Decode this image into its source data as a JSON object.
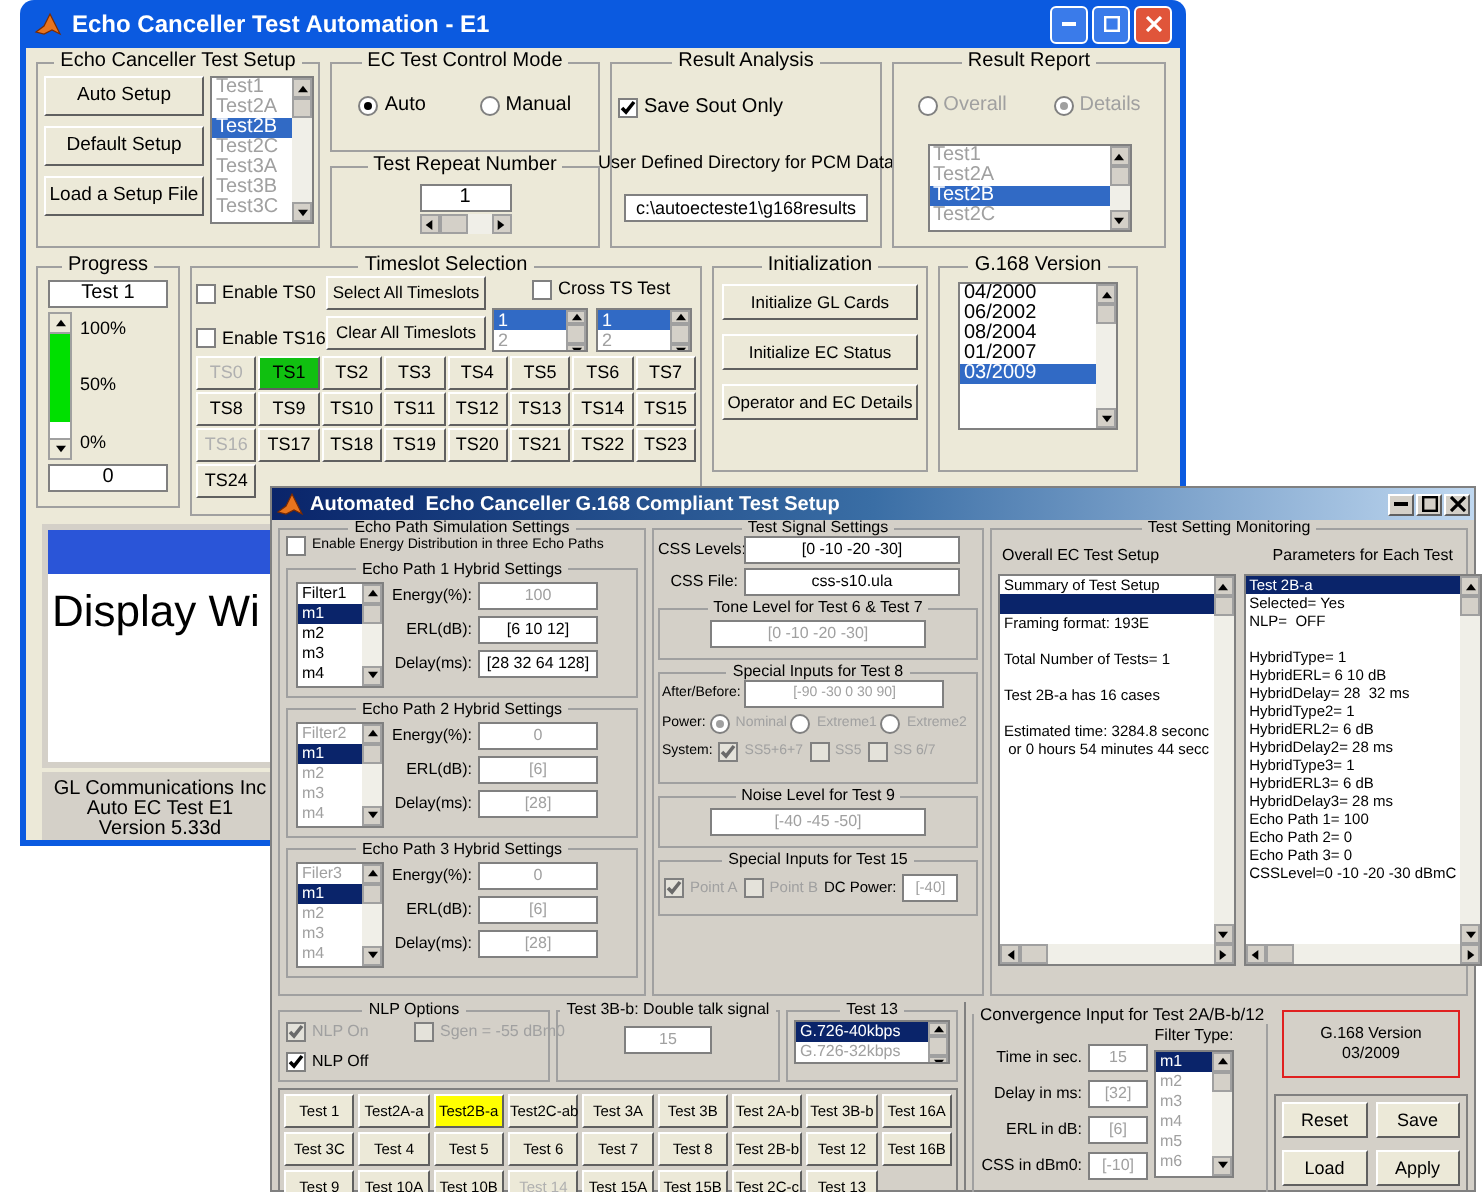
{
  "main": {
    "title": "Echo Canceller Test Automation - E1",
    "setup": {
      "title": "Echo Canceller Test Setup",
      "buttons": [
        "Auto Setup",
        "Default Setup",
        "Load a Setup File"
      ],
      "disabled": true,
      "list": [
        {
          "label": "Test1",
          "selected": false
        },
        {
          "label": "Test2A",
          "selected": false
        },
        {
          "label": "Test2B",
          "selected": true
        },
        {
          "label": "Test2C",
          "selected": false
        },
        {
          "label": "Test3A",
          "selected": false
        },
        {
          "label": "Test3B",
          "selected": false
        },
        {
          "label": "Test3C",
          "selected": false
        }
      ]
    },
    "control_mode": {
      "title": "EC Test Control Mode",
      "options": [
        {
          "label": "Auto",
          "selected": true
        },
        {
          "label": "Manual",
          "selected": false
        }
      ]
    },
    "repeat": {
      "title": "Test Repeat Number",
      "value": "1"
    },
    "analysis": {
      "title": "Result Analysis",
      "save": {
        "label": "Save Sout Only",
        "checked": true
      },
      "dir_label": "User Defined Directory for PCM Data",
      "dir_value": "c:\\autoecteste1\\g168results"
    },
    "report": {
      "title": "Result Report",
      "disabled": true,
      "options": [
        {
          "label": "Overall",
          "selected": false
        },
        {
          "label": "Details",
          "selected": true
        }
      ],
      "list": [
        {
          "label": "Test1",
          "selected": false
        },
        {
          "label": "Test2A",
          "selected": false
        },
        {
          "label": "Test2B",
          "selected": true
        },
        {
          "label": "Test2C",
          "selected": false
        }
      ]
    },
    "progress": {
      "title": "Progress",
      "test": "Test 1",
      "ticks": [
        "100%",
        "50%",
        "0%"
      ],
      "level": 0.85,
      "count": "0"
    },
    "timeslots": {
      "title": "Timeslot Selection",
      "enables": [
        {
          "label": "Enable TS0",
          "checked": false
        },
        {
          "label": "Enable TS16",
          "checked": false
        }
      ],
      "buttons": [
        "Select All Timeslots",
        "Clear All Timeslots"
      ],
      "cross": {
        "label": "Cross TS Test",
        "checked": false
      },
      "spins": [
        [
          {
            "label": "1",
            "selected": true
          },
          {
            "label": "2",
            "selected": false
          }
        ],
        [
          {
            "label": "1",
            "selected": true
          },
          {
            "label": "2",
            "selected": false
          }
        ]
      ],
      "slots": [
        {
          "label": "TS0",
          "selected": false,
          "disabled": true
        },
        {
          "label": "TS1",
          "selected": true,
          "disabled": false
        },
        {
          "label": "TS2",
          "selected": false,
          "disabled": false
        },
        {
          "label": "TS3",
          "selected": false,
          "disabled": false
        },
        {
          "label": "TS4",
          "selected": false,
          "disabled": false
        },
        {
          "label": "TS5",
          "selected": false,
          "disabled": false
        },
        {
          "label": "TS6",
          "selected": false,
          "disabled": false
        },
        {
          "label": "TS7",
          "selected": false,
          "disabled": false
        },
        {
          "label": "TS8",
          "selected": false,
          "disabled": false
        },
        {
          "label": "TS9",
          "selected": false,
          "disabled": false
        },
        {
          "label": "TS10",
          "selected": false,
          "disabled": false
        },
        {
          "label": "TS11",
          "selected": false,
          "disabled": false
        },
        {
          "label": "TS12",
          "selected": false,
          "disabled": false
        },
        {
          "label": "TS13",
          "selected": false,
          "disabled": false
        },
        {
          "label": "TS14",
          "selected": false,
          "disabled": false
        },
        {
          "label": "TS15",
          "selected": false,
          "disabled": false
        },
        {
          "label": "TS16",
          "selected": false,
          "disabled": true
        },
        {
          "label": "TS17",
          "selected": false,
          "disabled": false
        },
        {
          "label": "TS18",
          "selected": false,
          "disabled": false
        },
        {
          "label": "TS19",
          "selected": false,
          "disabled": false
        },
        {
          "label": "TS20",
          "selected": false,
          "disabled": false
        },
        {
          "label": "TS21",
          "selected": false,
          "disabled": false
        },
        {
          "label": "TS22",
          "selected": false,
          "disabled": false
        },
        {
          "label": "TS23",
          "selected": false,
          "disabled": false
        },
        {
          "label": "TS24",
          "selected": false,
          "disabled": false
        }
      ]
    },
    "init": {
      "title": "Initialization",
      "buttons": [
        "Initialize GL Cards",
        "Initialize EC Status",
        "Operator and EC Details"
      ]
    },
    "version": {
      "title": "G.168 Version",
      "list": [
        {
          "label": "04/2000",
          "selected": false
        },
        {
          "label": "06/2002",
          "selected": false
        },
        {
          "label": "08/2004",
          "selected": false
        },
        {
          "label": "01/2007",
          "selected": false
        },
        {
          "label": "03/2009",
          "selected": true
        }
      ]
    },
    "display": {
      "text": "Display Wi"
    },
    "footer": [
      "GL Communications Inc",
      "Auto EC Test E1",
      "Version 5.33d"
    ]
  },
  "dialog": {
    "title": "Automated  Echo Canceller G.168 Compliant Test Setup",
    "echo_sim": {
      "title": "Echo Path Simulation Settings",
      "distribute": {
        "label": "Enable Energy Distribution in three Echo Paths",
        "checked": false
      },
      "paths": [
        {
          "title": "Echo Path 1 Hybrid Settings",
          "disabled": false,
          "list": [
            {
              "label": "Filter1",
              "selected": false
            },
            {
              "label": "m1",
              "selected": true
            },
            {
              "label": "m2",
              "selected": false
            },
            {
              "label": "m3",
              "selected": false
            },
            {
              "label": "m4",
              "selected": false
            }
          ],
          "fields": [
            {
              "label": "Energy(%):",
              "value": "100",
              "disabled": true
            },
            {
              "label": "ERL(dB):",
              "value": "[6 10 12]",
              "disabled": false
            },
            {
              "label": "Delay(ms):",
              "value": "[28 32 64 128]",
              "disabled": false
            }
          ]
        },
        {
          "title": "Echo Path 2 Hybrid Settings",
          "disabled": true,
          "list": [
            {
              "label": "Filter2",
              "selected": false
            },
            {
              "label": "m1",
              "selected": true
            },
            {
              "label": "m2",
              "selected": false
            },
            {
              "label": "m3",
              "selected": false
            },
            {
              "label": "m4",
              "selected": false
            }
          ],
          "fields": [
            {
              "label": "Energy(%):",
              "value": "0",
              "disabled": true
            },
            {
              "label": "ERL(dB):",
              "value": "[6]",
              "disabled": true
            },
            {
              "label": "Delay(ms):",
              "value": "[28]",
              "disabled": true
            }
          ]
        },
        {
          "title": "Echo Path 3 Hybrid Settings",
          "disabled": true,
          "list": [
            {
              "label": "Filer3",
              "selected": false
            },
            {
              "label": "m1",
              "selected": true
            },
            {
              "label": "m2",
              "selected": false
            },
            {
              "label": "m3",
              "selected": false
            },
            {
              "label": "m4",
              "selected": false
            }
          ],
          "fields": [
            {
              "label": "Energy(%):",
              "value": "0",
              "disabled": true
            },
            {
              "label": "ERL(dB):",
              "value": "[6]",
              "disabled": true
            },
            {
              "label": "Delay(ms):",
              "value": "[28]",
              "disabled": true
            }
          ]
        }
      ]
    },
    "signal": {
      "title": "Test Signal Settings",
      "fields": [
        {
          "label": "CSS Levels:",
          "value": "[0 -10 -20 -30]",
          "disabled": false
        },
        {
          "label": "CSS File:",
          "value": "css-s10.ula",
          "disabled": false
        }
      ],
      "tone": {
        "title": "Tone Level for Test 6 & Test 7",
        "value": "[0 -10 -20 -30]",
        "disabled": true
      },
      "test8": {
        "title": "Special Inputs for Test 8",
        "disabled": true,
        "after_label": "After/Before:",
        "after_value": "[-90 -30 0 30 90]",
        "power_label": "Power:",
        "power": [
          {
            "label": "Nominal",
            "selected": true
          },
          {
            "label": "Extreme1",
            "selected": false
          },
          {
            "label": "Extreme2",
            "selected": false
          }
        ],
        "system_label": "System:",
        "system": [
          {
            "label": "SS5+6+7",
            "checked": true
          },
          {
            "label": "SS5",
            "checked": false
          },
          {
            "label": "SS 6/7",
            "checked": false
          }
        ]
      },
      "noise": {
        "title": "Noise Level for Test 9",
        "value": "[-40 -45 -50]",
        "disabled": true
      },
      "test15": {
        "title": "Special Inputs for Test 15",
        "disabled": true,
        "points": [
          {
            "label": "Point A",
            "checked": true
          },
          {
            "label": "Point B",
            "checked": false
          }
        ],
        "dc_label": "DC Power:",
        "dc_value": "[-40]"
      }
    },
    "monitor": {
      "title": "Test Setting Monitoring",
      "overall": {
        "title": "Overall EC Test Setup",
        "items": [
          {
            "kind": "text",
            "label": "Summary of Test Setup",
            "selected": false
          },
          {
            "kind": "blank",
            "selected": true
          },
          {
            "kind": "text",
            "label": "Framing format: 193E",
            "selected": false
          },
          {
            "kind": "gap"
          },
          {
            "kind": "text",
            "label": "Total Number of Tests= 1",
            "selected": false
          },
          {
            "kind": "gap"
          },
          {
            "kind": "text",
            "label": "Test 2B-a has 16 cases",
            "selected": false
          },
          {
            "kind": "gap"
          },
          {
            "kind": "text",
            "label": "Estimated time: 3284.8 seconc",
            "selected": false
          },
          {
            "kind": "text",
            "label": " or 0 hours 54 minutes 44 secc",
            "selected": false
          }
        ]
      },
      "params": {
        "title": "Parameters for Each Test",
        "items": [
          {
            "kind": "text",
            "label": "Test 2B-a",
            "selected": true
          },
          {
            "kind": "text",
            "label": "Selected= Yes",
            "selected": false
          },
          {
            "kind": "text",
            "label": "NLP=  OFF",
            "selected": false
          },
          {
            "kind": "gap"
          },
          {
            "kind": "text",
            "label": "HybridType= 1",
            "selected": false
          },
          {
            "kind": "text",
            "label": "HybridERL= 6 10 dB",
            "selected": false
          },
          {
            "kind": "text",
            "label": "HybridDelay= 28  32 ms",
            "selected": false
          },
          {
            "kind": "text",
            "label": "HybridType2= 1",
            "selected": false
          },
          {
            "kind": "text",
            "label": "HybridERL2= 6 dB",
            "selected": false
          },
          {
            "kind": "text",
            "label": "HybridDelay2= 28 ms",
            "selected": false
          },
          {
            "kind": "text",
            "label": "HybridType3= 1",
            "selected": false
          },
          {
            "kind": "text",
            "label": "HybridERL3= 6 dB",
            "selected": false
          },
          {
            "kind": "text",
            "label": "HybridDelay3= 28 ms",
            "selected": false
          },
          {
            "kind": "text",
            "label": "Echo Path 1= 100",
            "selected": false
          },
          {
            "kind": "text",
            "label": "Echo Path 2= 0",
            "selected": false
          },
          {
            "kind": "text",
            "label": "Echo Path 3= 0",
            "selected": false
          },
          {
            "kind": "text",
            "label": "CSSLevel=0 -10 -20 -30 dBmC",
            "selected": false
          }
        ]
      }
    },
    "nlp": {
      "title": "NLP Options",
      "options": [
        {
          "label": "NLP On",
          "checked": true,
          "disabled": true
        },
        {
          "label": "Sgen = -55 dBm0",
          "checked": false,
          "disabled": true
        },
        {
          "label": "NLP Off",
          "checked": true,
          "disabled": false
        }
      ]
    },
    "double_talk": {
      "title": "Test 3B-b: Double talk signal",
      "value": "15"
    },
    "test13": {
      "title": "Test 13",
      "list": [
        {
          "label": "G.726-40kbps",
          "selected": true
        },
        {
          "label": "G.726-32kbps",
          "selected": false
        }
      ]
    },
    "tests": [
      {
        "label": "Test 1",
        "selected": false,
        "disabled": false
      },
      {
        "label": "Test2A-a",
        "selected": false,
        "disabled": false
      },
      {
        "label": "Test2B-a",
        "selected": true,
        "disabled": false
      },
      {
        "label": "Test2C-ab",
        "selected": false,
        "disabled": false
      },
      {
        "label": "Test 3A",
        "selected": false,
        "disabled": false
      },
      {
        "label": "Test 3B",
        "selected": false,
        "disabled": false
      },
      {
        "label": "Test 2A-b",
        "selected": false,
        "disabled": false
      },
      {
        "label": "Test 3B-b",
        "selected": false,
        "disabled": false
      },
      {
        "label": "Test 16A",
        "selected": false,
        "disabled": false
      },
      {
        "label": "Test 3C",
        "selected": false,
        "disabled": false
      },
      {
        "label": "Test 4",
        "selected": false,
        "disabled": false
      },
      {
        "label": "Test 5",
        "selected": false,
        "disabled": false
      },
      {
        "label": "Test 6",
        "selected": false,
        "disabled": false
      },
      {
        "label": "Test 7",
        "selected": false,
        "disabled": false
      },
      {
        "label": "Test 8",
        "selected": false,
        "disabled": false
      },
      {
        "label": "Test 2B-b",
        "selected": false,
        "disabled": false
      },
      {
        "label": "Test 12",
        "selected": false,
        "disabled": false
      },
      {
        "label": "Test 16B",
        "selected": false,
        "disabled": false
      },
      {
        "label": "Test 9",
        "selected": false,
        "disabled": false
      },
      {
        "label": "Test 10A",
        "selected": false,
        "disabled": false
      },
      {
        "label": "Test 10B",
        "selected": false,
        "disabled": false
      },
      {
        "label": "Test 14",
        "selected": false,
        "disabled": true
      },
      {
        "label": "Test 15A",
        "selected": false,
        "disabled": false
      },
      {
        "label": "Test 15B",
        "selected": false,
        "disabled": false
      },
      {
        "label": "Test 2C-c",
        "selected": false,
        "disabled": false
      },
      {
        "label": "Test 13",
        "selected": false,
        "disabled": false
      }
    ],
    "convergence": {
      "title": "Convergence Input for Test 2A/B-b/12",
      "fields": [
        {
          "label": "Time in sec.",
          "value": "15",
          "disabled": true
        },
        {
          "label": "Delay in ms:",
          "value": "[32]",
          "disabled": true
        },
        {
          "label": "ERL in dB:",
          "value": "[6]",
          "disabled": true
        },
        {
          "label": "CSS in dBm0:",
          "value": "[-10]",
          "disabled": true
        }
      ],
      "filter_label": "Filter Type:",
      "filter": [
        {
          "label": "m1",
          "selected": true
        },
        {
          "label": "m2",
          "selected": false
        },
        {
          "label": "m3",
          "selected": false
        },
        {
          "label": "m4",
          "selected": false
        },
        {
          "label": "m5",
          "selected": false
        },
        {
          "label": "m6",
          "selected": false
        }
      ]
    },
    "version_box": [
      "G.168 Version",
      "03/2009"
    ],
    "actions": [
      "Reset",
      "Save",
      "Load",
      "Apply"
    ]
  }
}
